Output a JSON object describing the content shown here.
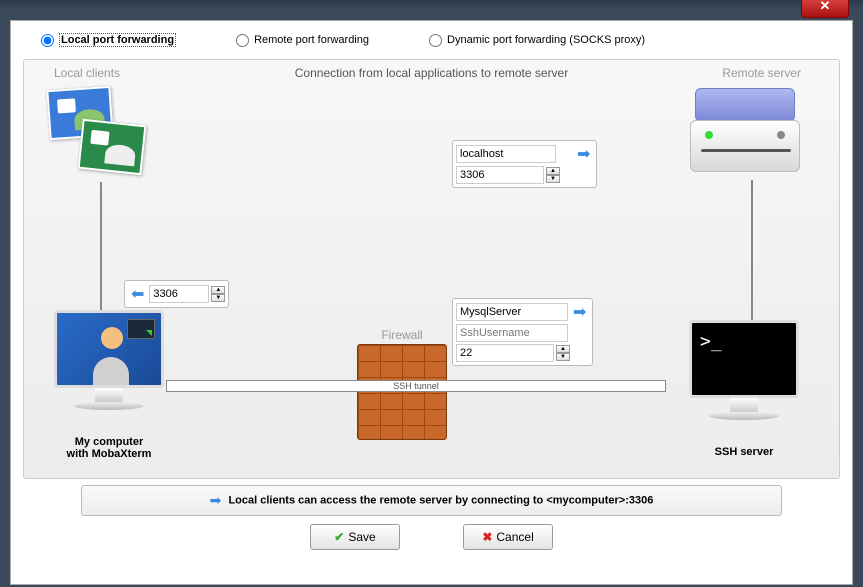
{
  "radios": {
    "local": "Local port forwarding",
    "remote": "Remote port forwarding",
    "dynamic": "Dynamic port forwarding (SOCKS proxy)"
  },
  "labels": {
    "local_clients": "Local clients",
    "remote_server": "Remote server",
    "firewall": "Firewall",
    "ssh_tunnel": "SSH tunnel",
    "description": "Connection from local applications to remote server",
    "my_computer_line1": "My computer",
    "my_computer_line2": "with MobaXterm",
    "ssh_server": "SSH server"
  },
  "fields": {
    "local_port": "3306",
    "remote_host": "localhost",
    "remote_port": "3306",
    "ssh_host": "MysqlServer",
    "ssh_user_placeholder": "SshUsername",
    "ssh_port": "22"
  },
  "terminal_prompt": ">_",
  "info_text": "Local clients can access the remote server by connecting to <mycomputer>:3306",
  "buttons": {
    "save": "Save",
    "cancel": "Cancel"
  }
}
